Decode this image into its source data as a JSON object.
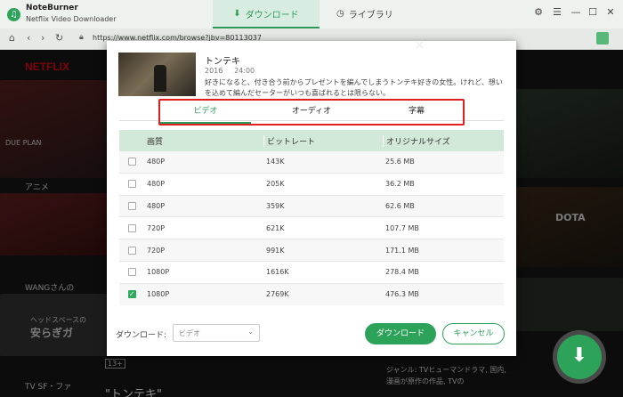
{
  "app": {
    "brand": "NoteBurner",
    "product": "Netflix Video Downloader",
    "tab_download": "ダウンロード",
    "tab_library": "ライブラリ"
  },
  "browser": {
    "url": "https://www.netflix.com/browse?jbv=80113037"
  },
  "background": {
    "logo": "NETFLIX",
    "label_anime": "アニメ",
    "label_wang": "WANGさんの",
    "label_sf": "TV SF・ファ",
    "bottom_title": "\"トンテキ\"",
    "promo_a": "ヘッドスペースの",
    "promo_b": "安らぎガ",
    "rating": "13+",
    "genre_a": "ジャンル: TVヒューマンドラマ, 国内,",
    "genre_b": "漫画が原作の作品, TVの",
    "dota": "DOTA",
    "dueplan": "DUE PLAN"
  },
  "dialog": {
    "title": "トンテキ",
    "year": "2016",
    "duration": "24:00",
    "description": "好きになると、付き合う前からプレゼントを編んでしまうトンテキ好きの女性。けれど、想いを込めて編んだセーターがいつも喜ばれるとは限らない。",
    "tabs": [
      "ビデオ",
      "オーディオ",
      "字幕"
    ],
    "active_tab": 0,
    "columns": [
      "画質",
      "ビットレート",
      "オリジナルサイズ"
    ],
    "rows": [
      {
        "quality": "480P",
        "bitrate": "143K",
        "size": "25.6 MB",
        "checked": false
      },
      {
        "quality": "480P",
        "bitrate": "205K",
        "size": "36.2 MB",
        "checked": false
      },
      {
        "quality": "480P",
        "bitrate": "359K",
        "size": "62.6 MB",
        "checked": false
      },
      {
        "quality": "720P",
        "bitrate": "621K",
        "size": "107.7 MB",
        "checked": false
      },
      {
        "quality": "720P",
        "bitrate": "991K",
        "size": "171.1 MB",
        "checked": false
      },
      {
        "quality": "1080P",
        "bitrate": "1616K",
        "size": "278.4 MB",
        "checked": false
      },
      {
        "quality": "1080P",
        "bitrate": "2769K",
        "size": "476.3 MB",
        "checked": true
      }
    ],
    "download_label": "ダウンロード:",
    "download_type": "ビデオ",
    "download_button": "ダウンロード",
    "cancel_button": "キャンセル"
  },
  "colors": {
    "accent": "#2da35a",
    "highlight_box": "#e02020",
    "header_row": "#d2e8d8"
  }
}
